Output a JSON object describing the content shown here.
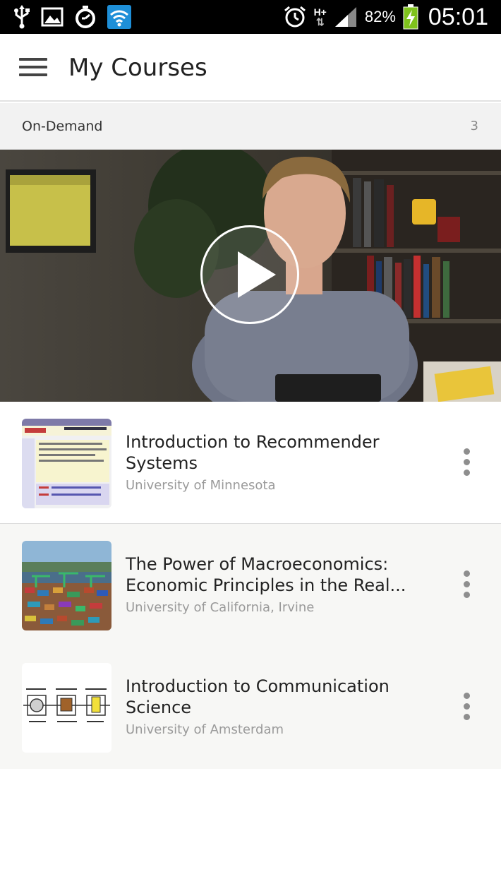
{
  "status_bar": {
    "battery_percent": "82%",
    "time": "05:01",
    "network": "H+",
    "icons": [
      "usb-icon",
      "image-icon",
      "timer-icon",
      "wifi-icon",
      "alarm-icon",
      "network-icon",
      "signal-icon",
      "battery-charging-icon"
    ]
  },
  "app_bar": {
    "title": "My Courses",
    "menu_icon": "hamburger-menu-icon"
  },
  "section": {
    "label": "On-Demand",
    "count": "3"
  },
  "hero": {
    "play_icon": "play-icon"
  },
  "courses": [
    {
      "title": "Introduction to Recommender Systems",
      "university": "University of Minnesota"
    },
    {
      "title": "The Power of Macroeconomics: Economic Principles in the Real...",
      "university": "University of California, Irvine"
    },
    {
      "title": "Introduction to Communication Science",
      "university": "University of Amsterdam"
    }
  ],
  "colors": {
    "status_bar": "#000000",
    "section_bg": "#f2f2f2",
    "row_bg_alt": "#f7f7f5",
    "title_text": "#222222",
    "subtitle_text": "#9a9a9a",
    "wifi_accent": "#1e8fd8",
    "battery_accent": "#7fc31c"
  }
}
